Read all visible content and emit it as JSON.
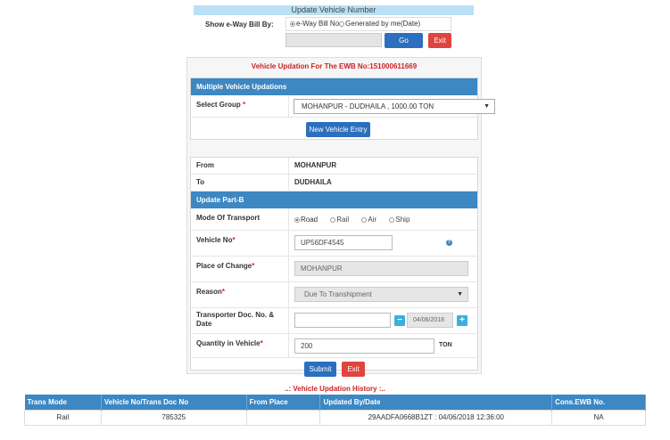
{
  "header": {
    "title": "Update Vehicle Number",
    "show_label": "Show e-Way Bill By:",
    "radio_options": [
      "e-Way Bill No",
      "Generated by me(Date)"
    ],
    "go_label": "Go",
    "exit_label": "Exit"
  },
  "panel": {
    "ewb_heading": "Vehicle Updation For The EWB No:151000611669",
    "multi_heading": "Multiple Vehicle Updations",
    "select_group_label": "Select Group",
    "select_group_value": "MOHANPUR - DUDHAILA , 1000.00 TON",
    "new_vehicle_label": "New Vehicle Entry",
    "from_label": "From",
    "from_value": "MOHANPUR",
    "to_label": "To",
    "to_value": "DUDHAILA",
    "part_b_heading": "Update Part-B",
    "mode_label": "Mode Of Transport",
    "modes": [
      "Road",
      "Rail",
      "Air",
      "Ship"
    ],
    "vehicle_no_label": "Vehicle No",
    "vehicle_no_value": "UP56DF4545",
    "place_label": "Place of Change",
    "place_value": "MOHANPUR",
    "reason_label": "Reason",
    "reason_value": "Due To Transhipment",
    "transporter_label": "Transporter Doc. No. & Date",
    "transporter_doc_value": "",
    "transporter_date_value": "04/06/2018",
    "quantity_label": "Quantity in Vehicle",
    "quantity_value": "200",
    "quantity_unit": "TON",
    "submit_label": "Submit",
    "exit_label": "Exit"
  },
  "history": {
    "title": "..: Vehicle Updation History :..",
    "columns": [
      "Trans Mode",
      "Vehicle No/Trans Doc No",
      "From Place",
      "Updated By/Date",
      "Cons.EWB No."
    ],
    "rows": [
      [
        "Rail",
        "785325",
        "",
        "29AADFA0668B1ZT : 04/06/2018 12:36:00",
        "NA"
      ]
    ]
  }
}
